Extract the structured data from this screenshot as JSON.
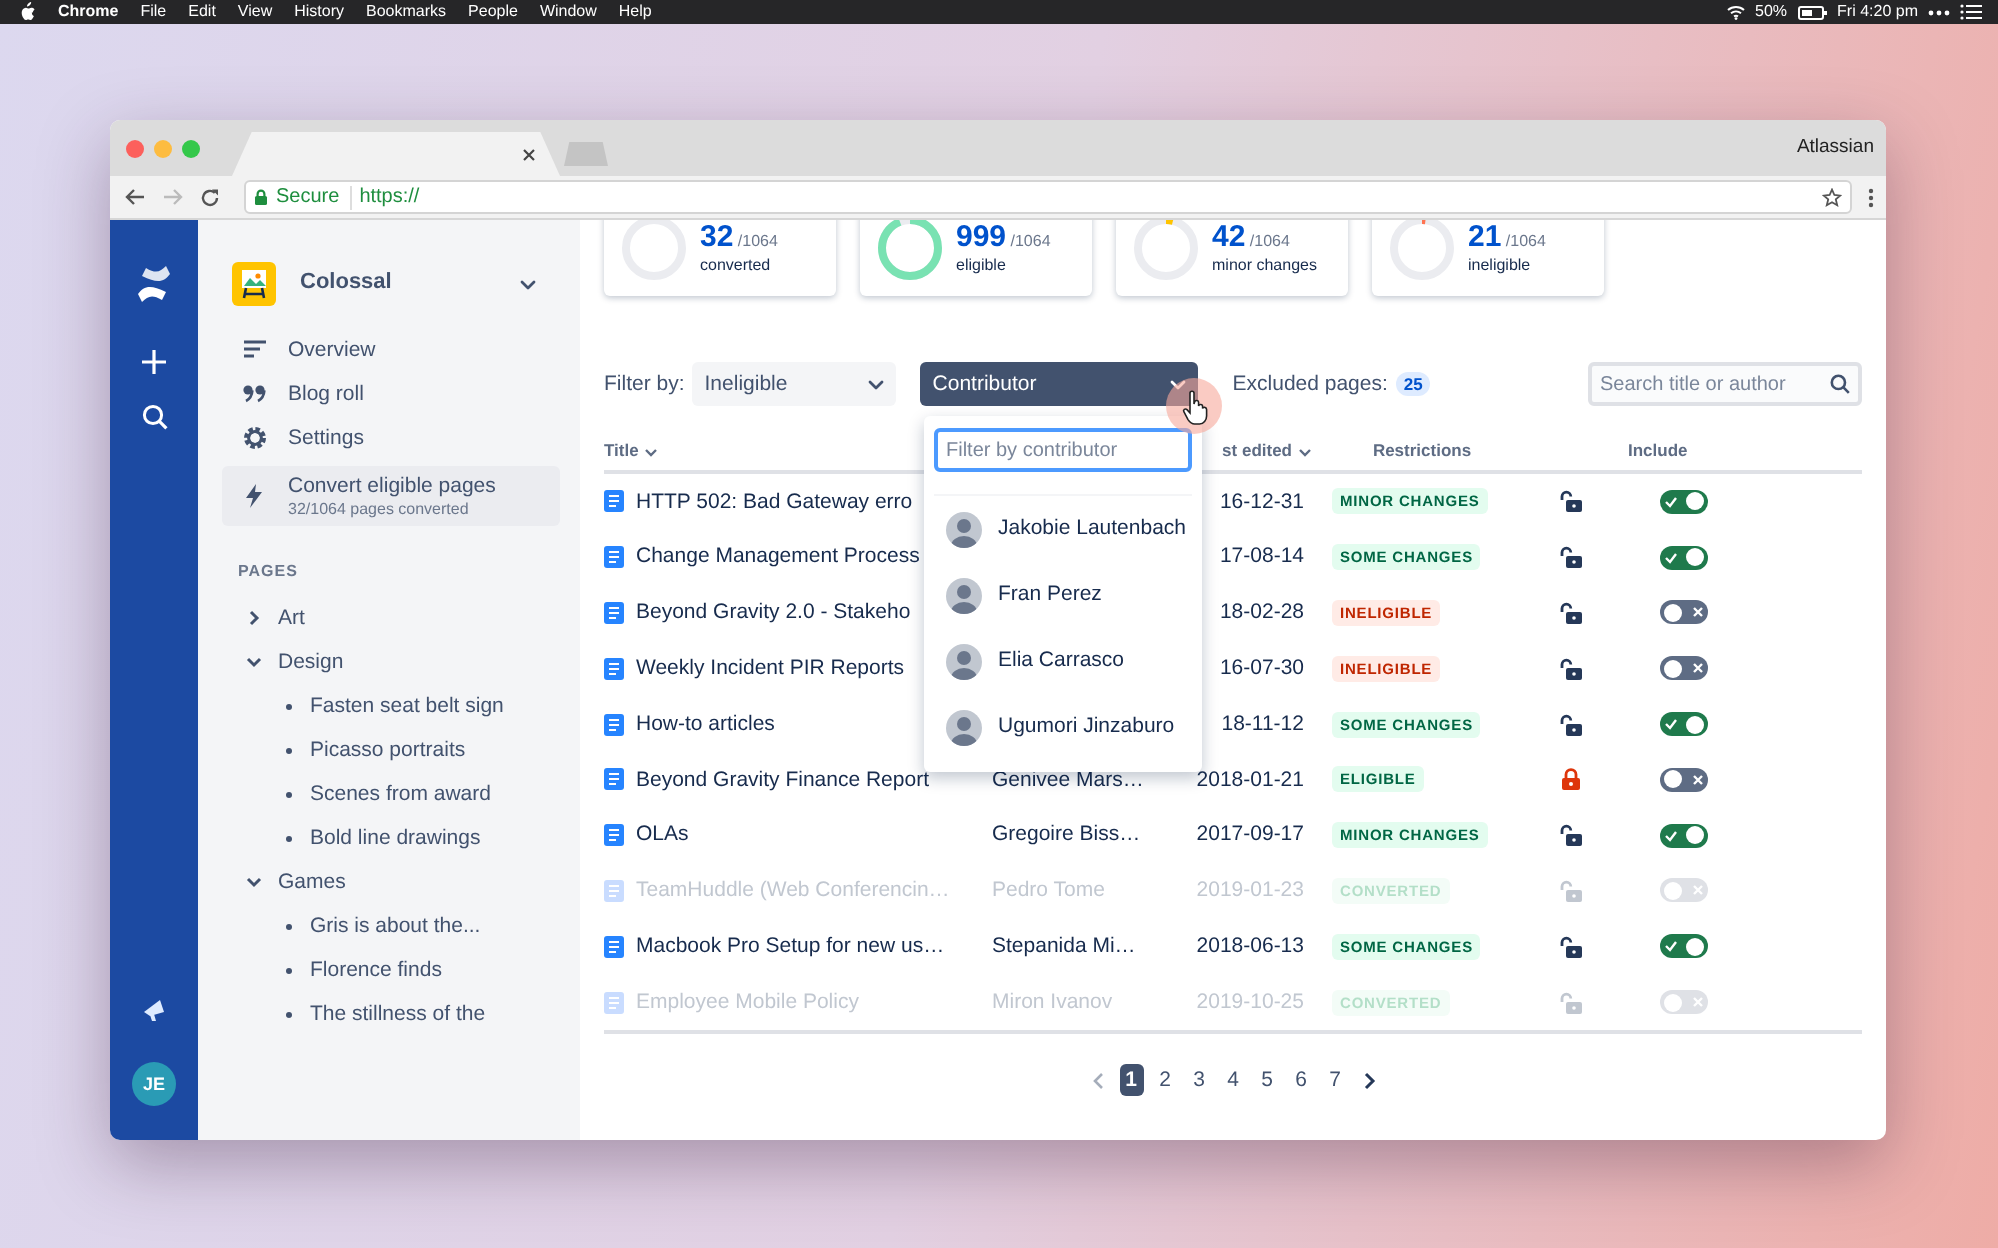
{
  "menu_bar": {
    "app": "Chrome",
    "menus": [
      "File",
      "Edit",
      "View",
      "History",
      "Bookmarks",
      "People",
      "Window",
      "Help"
    ],
    "battery": "50%",
    "clock": "Fri 4:20 pm"
  },
  "browser": {
    "profile": "Atlassian",
    "secure_label": "Secure",
    "url": "https://"
  },
  "rail": {
    "avatar_initials": "JE"
  },
  "space": {
    "name": "Colossal"
  },
  "nav": [
    {
      "label": "Overview",
      "selected": false
    },
    {
      "label": "Blog roll",
      "selected": false
    },
    {
      "label": "Settings",
      "selected": false
    },
    {
      "label": "Convert eligible pages",
      "sublabel": "32/1064 pages converted",
      "selected": true
    }
  ],
  "pages_heading": "PAGES",
  "tree": [
    {
      "label": "Art",
      "expanded": false
    },
    {
      "label": "Design",
      "expanded": true,
      "children": [
        {
          "label": "Fasten seat belt sign"
        },
        {
          "label": "Picasso portraits"
        },
        {
          "label": "Scenes from award"
        },
        {
          "label": "Bold line drawings"
        }
      ]
    },
    {
      "label": "Games",
      "expanded": true,
      "children": [
        {
          "label": "Gris is about the..."
        },
        {
          "label": "Florence finds"
        },
        {
          "label": "The stillness of the"
        }
      ]
    }
  ],
  "stats": [
    {
      "count": "32",
      "total": "/1064",
      "label": "converted"
    },
    {
      "count": "999",
      "total": "/1064",
      "label": "eligible",
      "level": 0.94,
      "color": "#79e2b2"
    },
    {
      "count": "42",
      "total": "/1064",
      "label": "minor changes",
      "level": 0.04,
      "color": "#ffc400"
    },
    {
      "count": "21",
      "total": "/1064",
      "label": "ineligible",
      "level": 0.02,
      "color": "#ff7452"
    }
  ],
  "filter": {
    "label": "Filter by:",
    "status_value": "Ineligible",
    "contributor_value": "Contributor",
    "excluded_label": "Excluded pages:",
    "excluded_count": "25",
    "search_placeholder": "Search title or author"
  },
  "contributor_menu": {
    "open": true,
    "placeholder": "Filter by contributor",
    "items": [
      {
        "name": "Jakobie Lautenbach"
      },
      {
        "name": "Fran Perez"
      },
      {
        "name": "Elia Carrasco"
      },
      {
        "name": "Ugumori Jinzaburo"
      }
    ]
  },
  "table": {
    "header": {
      "title": "Title",
      "last_edited": "st edited",
      "restrictions": "Restrictions",
      "include": "Include"
    },
    "rows": [
      {
        "title": "HTTP 502: Bad Gateway erro",
        "edited": "16-12-31",
        "status": "MINOR CHANGES",
        "kind": "changes",
        "restricted": false,
        "included": true,
        "disabled": false
      },
      {
        "title": "Change Management Process",
        "edited": "17-08-14",
        "status": "SOME CHANGES",
        "kind": "changes",
        "restricted": false,
        "included": true,
        "disabled": false
      },
      {
        "title": "Beyond Gravity 2.0 - Stakeho",
        "edited": "18-02-28",
        "status": "INELIGIBLE",
        "kind": "ineligible",
        "restricted": false,
        "included": false,
        "disabled": false
      },
      {
        "title": "Weekly Incident PIR Reports",
        "edited": "16-07-30",
        "status": "INELIGIBLE",
        "kind": "ineligible",
        "restricted": false,
        "included": false,
        "disabled": false
      },
      {
        "title": "How-to articles",
        "edited": "18-11-12",
        "status": "SOME CHANGES",
        "kind": "changes",
        "restricted": false,
        "included": true,
        "disabled": false
      },
      {
        "title": "Beyond Gravity Finance Report",
        "author": "Genivee Mars…",
        "edited": "2018-01-21",
        "status": "ELIGIBLE",
        "kind": "changes",
        "restricted": true,
        "included": false,
        "disabled": false
      },
      {
        "title": "OLAs",
        "author": "Gregoire Biss…",
        "edited": "2017-09-17",
        "status": "MINOR CHANGES",
        "kind": "changes",
        "restricted": false,
        "included": true,
        "disabled": false
      },
      {
        "title": "TeamHuddle (Web Conferencin…",
        "author": "Pedro Tome",
        "edited": "2019-01-23",
        "status": "CONVERTED",
        "kind": "changes",
        "restricted": false,
        "included": false,
        "disabled": true
      },
      {
        "title": "Macbook Pro Setup for new us…",
        "author": "Stepanida Mi…",
        "edited": "2018-06-13",
        "status": "SOME CHANGES",
        "kind": "changes",
        "restricted": false,
        "included": true,
        "disabled": false
      },
      {
        "title": "Employee Mobile Policy",
        "author": "Miron Ivanov",
        "edited": "2019-10-25",
        "status": "CONVERTED",
        "kind": "changes",
        "restricted": false,
        "included": false,
        "disabled": true
      }
    ]
  },
  "pagination": {
    "prev_disabled": true,
    "pages": [
      {
        "label": "1",
        "selected": true
      },
      {
        "label": "2",
        "selected": false
      },
      {
        "label": "3",
        "selected": false
      },
      {
        "label": "4",
        "selected": false
      },
      {
        "label": "5",
        "selected": false
      },
      {
        "label": "6",
        "selected": false
      },
      {
        "label": "7",
        "selected": false
      }
    ]
  }
}
